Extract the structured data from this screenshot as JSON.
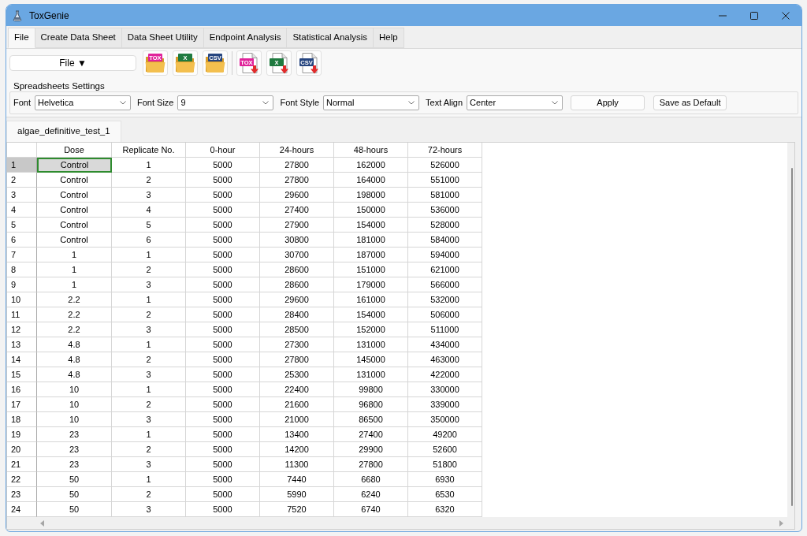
{
  "window": {
    "title": "ToxGenie"
  },
  "menu_tabs": [
    {
      "label": "File",
      "selected": true
    },
    {
      "label": "Create Data Sheet",
      "selected": false
    },
    {
      "label": "Data Sheet Utility",
      "selected": false
    },
    {
      "label": "Endpoint Analysis",
      "selected": false
    },
    {
      "label": "Statistical Analysis",
      "selected": false
    },
    {
      "label": "Help",
      "selected": false
    }
  ],
  "toolbar": {
    "file_menu": {
      "label": "File ▼"
    },
    "buttons": [
      {
        "kind": "open",
        "tag": "TOX",
        "color": "#e0239a"
      },
      {
        "kind": "open",
        "tag": "X",
        "color": "#1f7a3f"
      },
      {
        "kind": "open",
        "tag": "CSV",
        "color": "#26457f"
      },
      {
        "kind": "save",
        "tag": "TOX",
        "color": "#e0239a"
      },
      {
        "kind": "save",
        "tag": "X",
        "color": "#1f7a3f"
      },
      {
        "kind": "save",
        "tag": "CSV",
        "color": "#26457f"
      }
    ]
  },
  "settings": {
    "title": "Spreadsheets Settings",
    "fields": [
      {
        "label": "Font",
        "value": "Helvetica"
      },
      {
        "label": "Font Size",
        "value": "9"
      },
      {
        "label": "Font Style",
        "value": "Normal"
      },
      {
        "label": "Text Align",
        "value": "Center"
      }
    ],
    "buttons": [
      "Apply",
      "Save as Default"
    ]
  },
  "sheet_tabs": [
    {
      "label": "algae_definitive_test_1",
      "selected": true
    }
  ],
  "table": {
    "columns": [
      "Dose",
      "Replicate No.",
      "0-hour",
      "24-hours",
      "48-hours",
      "72-hours"
    ],
    "rows": [
      {
        "number": "1",
        "cells": [
          {
            "value": "Control",
            "selected": true
          },
          {
            "value": "1",
            "selected": false
          },
          {
            "value": "5000",
            "selected": false
          },
          {
            "value": "27800",
            "selected": false
          },
          {
            "value": "162000",
            "selected": false
          },
          {
            "value": "526000",
            "selected": false
          }
        ]
      },
      {
        "number": "2",
        "cells": [
          {
            "value": "Control",
            "selected": false
          },
          {
            "value": "2",
            "selected": false
          },
          {
            "value": "5000",
            "selected": false
          },
          {
            "value": "27800",
            "selected": false
          },
          {
            "value": "164000",
            "selected": false
          },
          {
            "value": "551000",
            "selected": false
          }
        ]
      },
      {
        "number": "3",
        "cells": [
          {
            "value": "Control",
            "selected": false
          },
          {
            "value": "3",
            "selected": false
          },
          {
            "value": "5000",
            "selected": false
          },
          {
            "value": "29600",
            "selected": false
          },
          {
            "value": "198000",
            "selected": false
          },
          {
            "value": "581000",
            "selected": false
          }
        ]
      },
      {
        "number": "4",
        "cells": [
          {
            "value": "Control",
            "selected": false
          },
          {
            "value": "4",
            "selected": false
          },
          {
            "value": "5000",
            "selected": false
          },
          {
            "value": "27400",
            "selected": false
          },
          {
            "value": "150000",
            "selected": false
          },
          {
            "value": "536000",
            "selected": false
          }
        ]
      },
      {
        "number": "5",
        "cells": [
          {
            "value": "Control",
            "selected": false
          },
          {
            "value": "5",
            "selected": false
          },
          {
            "value": "5000",
            "selected": false
          },
          {
            "value": "27900",
            "selected": false
          },
          {
            "value": "154000",
            "selected": false
          },
          {
            "value": "528000",
            "selected": false
          }
        ]
      },
      {
        "number": "6",
        "cells": [
          {
            "value": "Control",
            "selected": false
          },
          {
            "value": "6",
            "selected": false
          },
          {
            "value": "5000",
            "selected": false
          },
          {
            "value": "30800",
            "selected": false
          },
          {
            "value": "181000",
            "selected": false
          },
          {
            "value": "584000",
            "selected": false
          }
        ]
      },
      {
        "number": "7",
        "cells": [
          {
            "value": "1",
            "selected": false
          },
          {
            "value": "1",
            "selected": false
          },
          {
            "value": "5000",
            "selected": false
          },
          {
            "value": "30700",
            "selected": false
          },
          {
            "value": "187000",
            "selected": false
          },
          {
            "value": "594000",
            "selected": false
          }
        ]
      },
      {
        "number": "8",
        "cells": [
          {
            "value": "1",
            "selected": false
          },
          {
            "value": "2",
            "selected": false
          },
          {
            "value": "5000",
            "selected": false
          },
          {
            "value": "28600",
            "selected": false
          },
          {
            "value": "151000",
            "selected": false
          },
          {
            "value": "621000",
            "selected": false
          }
        ]
      },
      {
        "number": "9",
        "cells": [
          {
            "value": "1",
            "selected": false
          },
          {
            "value": "3",
            "selected": false
          },
          {
            "value": "5000",
            "selected": false
          },
          {
            "value": "28600",
            "selected": false
          },
          {
            "value": "179000",
            "selected": false
          },
          {
            "value": "566000",
            "selected": false
          }
        ]
      },
      {
        "number": "10",
        "cells": [
          {
            "value": "2.2",
            "selected": false
          },
          {
            "value": "1",
            "selected": false
          },
          {
            "value": "5000",
            "selected": false
          },
          {
            "value": "29600",
            "selected": false
          },
          {
            "value": "161000",
            "selected": false
          },
          {
            "value": "532000",
            "selected": false
          }
        ]
      },
      {
        "number": "11",
        "cells": [
          {
            "value": "2.2",
            "selected": false
          },
          {
            "value": "2",
            "selected": false
          },
          {
            "value": "5000",
            "selected": false
          },
          {
            "value": "28400",
            "selected": false
          },
          {
            "value": "154000",
            "selected": false
          },
          {
            "value": "506000",
            "selected": false
          }
        ]
      },
      {
        "number": "12",
        "cells": [
          {
            "value": "2.2",
            "selected": false
          },
          {
            "value": "3",
            "selected": false
          },
          {
            "value": "5000",
            "selected": false
          },
          {
            "value": "28500",
            "selected": false
          },
          {
            "value": "152000",
            "selected": false
          },
          {
            "value": "511000",
            "selected": false
          }
        ]
      },
      {
        "number": "13",
        "cells": [
          {
            "value": "4.8",
            "selected": false
          },
          {
            "value": "1",
            "selected": false
          },
          {
            "value": "5000",
            "selected": false
          },
          {
            "value": "27300",
            "selected": false
          },
          {
            "value": "131000",
            "selected": false
          },
          {
            "value": "434000",
            "selected": false
          }
        ]
      },
      {
        "number": "14",
        "cells": [
          {
            "value": "4.8",
            "selected": false
          },
          {
            "value": "2",
            "selected": false
          },
          {
            "value": "5000",
            "selected": false
          },
          {
            "value": "27800",
            "selected": false
          },
          {
            "value": "145000",
            "selected": false
          },
          {
            "value": "463000",
            "selected": false
          }
        ]
      },
      {
        "number": "15",
        "cells": [
          {
            "value": "4.8",
            "selected": false
          },
          {
            "value": "3",
            "selected": false
          },
          {
            "value": "5000",
            "selected": false
          },
          {
            "value": "25300",
            "selected": false
          },
          {
            "value": "131000",
            "selected": false
          },
          {
            "value": "422000",
            "selected": false
          }
        ]
      },
      {
        "number": "16",
        "cells": [
          {
            "value": "10",
            "selected": false
          },
          {
            "value": "1",
            "selected": false
          },
          {
            "value": "5000",
            "selected": false
          },
          {
            "value": "22400",
            "selected": false
          },
          {
            "value": "99800",
            "selected": false
          },
          {
            "value": "330000",
            "selected": false
          }
        ]
      },
      {
        "number": "17",
        "cells": [
          {
            "value": "10",
            "selected": false
          },
          {
            "value": "2",
            "selected": false
          },
          {
            "value": "5000",
            "selected": false
          },
          {
            "value": "21600",
            "selected": false
          },
          {
            "value": "96800",
            "selected": false
          },
          {
            "value": "339000",
            "selected": false
          }
        ]
      },
      {
        "number": "18",
        "cells": [
          {
            "value": "10",
            "selected": false
          },
          {
            "value": "3",
            "selected": false
          },
          {
            "value": "5000",
            "selected": false
          },
          {
            "value": "21000",
            "selected": false
          },
          {
            "value": "86500",
            "selected": false
          },
          {
            "value": "350000",
            "selected": false
          }
        ]
      },
      {
        "number": "19",
        "cells": [
          {
            "value": "23",
            "selected": false
          },
          {
            "value": "1",
            "selected": false
          },
          {
            "value": "5000",
            "selected": false
          },
          {
            "value": "13400",
            "selected": false
          },
          {
            "value": "27400",
            "selected": false
          },
          {
            "value": "49200",
            "selected": false
          }
        ]
      },
      {
        "number": "20",
        "cells": [
          {
            "value": "23",
            "selected": false
          },
          {
            "value": "2",
            "selected": false
          },
          {
            "value": "5000",
            "selected": false
          },
          {
            "value": "14200",
            "selected": false
          },
          {
            "value": "29900",
            "selected": false
          },
          {
            "value": "52600",
            "selected": false
          }
        ]
      },
      {
        "number": "21",
        "cells": [
          {
            "value": "23",
            "selected": false
          },
          {
            "value": "3",
            "selected": false
          },
          {
            "value": "5000",
            "selected": false
          },
          {
            "value": "11300",
            "selected": false
          },
          {
            "value": "27800",
            "selected": false
          },
          {
            "value": "51800",
            "selected": false
          }
        ]
      },
      {
        "number": "22",
        "cells": [
          {
            "value": "50",
            "selected": false
          },
          {
            "value": "1",
            "selected": false
          },
          {
            "value": "5000",
            "selected": false
          },
          {
            "value": "7440",
            "selected": false
          },
          {
            "value": "6680",
            "selected": false
          },
          {
            "value": "6930",
            "selected": false
          }
        ]
      },
      {
        "number": "23",
        "cells": [
          {
            "value": "50",
            "selected": false
          },
          {
            "value": "2",
            "selected": false
          },
          {
            "value": "5000",
            "selected": false
          },
          {
            "value": "5990",
            "selected": false
          },
          {
            "value": "6240",
            "selected": false
          },
          {
            "value": "6530",
            "selected": false
          }
        ]
      },
      {
        "number": "24",
        "cells": [
          {
            "value": "50",
            "selected": false
          },
          {
            "value": "3",
            "selected": false
          },
          {
            "value": "5000",
            "selected": false
          },
          {
            "value": "7520",
            "selected": false
          },
          {
            "value": "6740",
            "selected": false
          },
          {
            "value": "6320",
            "selected": false
          }
        ]
      }
    ]
  }
}
